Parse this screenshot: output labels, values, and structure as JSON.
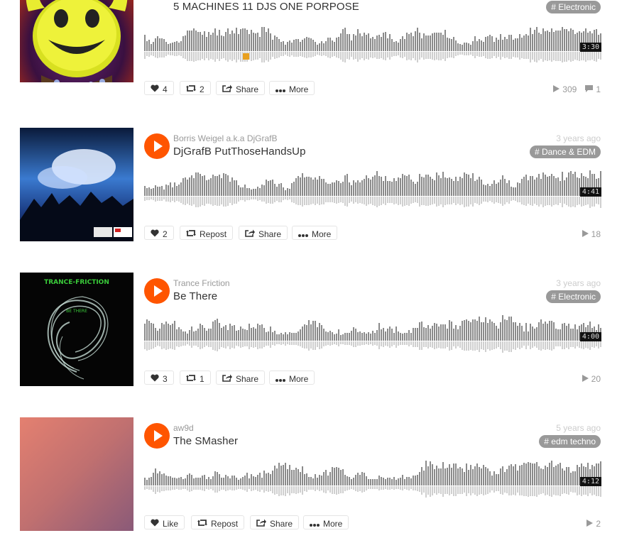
{
  "tracks": [
    {
      "uploader": "",
      "title": "5 MACHINES 11 DJS ONE PORPOSE",
      "posted": "",
      "genre": "# Electronic",
      "duration": "3:30",
      "actions": {
        "like": "4",
        "repost": "2",
        "share": "Share",
        "more": "More"
      },
      "stats": {
        "plays": "309",
        "comments": "1"
      },
      "artwork": "smiley-face-artwork"
    },
    {
      "uploader": "Borris Weigel a.k.a DjGrafB",
      "title": "DjGrafB PutThoseHandsUp",
      "posted": "3 years ago",
      "genre": "# Dance & EDM",
      "duration": "4:41",
      "actions": {
        "like": "2",
        "repost": "Repost",
        "share": "Share",
        "more": "More"
      },
      "stats": {
        "plays": "18"
      },
      "artwork": "crowd-hands-artwork"
    },
    {
      "uploader": "Trance Friction",
      "title": "Be There",
      "posted": "3 years ago",
      "genre": "# Electronic",
      "duration": "4:00",
      "actions": {
        "like": "3",
        "repost": "1",
        "share": "Share",
        "more": "More"
      },
      "stats": {
        "plays": "20"
      },
      "artwork": "trance-friction-artwork",
      "artwork_text": {
        "top": "TRANCE-FRICTION",
        "middle": "BE THERE"
      }
    },
    {
      "uploader": "aw9d",
      "title": "The SMasher",
      "posted": "5 years ago",
      "genre": "# edm techno",
      "duration": "4:12",
      "actions": {
        "like": "Like",
        "repost": "Repost",
        "share": "Share",
        "more": "More"
      },
      "stats": {
        "plays": "2"
      },
      "artwork": "gradient-artwork"
    }
  ],
  "colors": {
    "accent": "#ff5500",
    "waveform_top": "#8a8a8a",
    "waveform_bottom": "#cfcfcf",
    "genre_bg": "#999999"
  }
}
